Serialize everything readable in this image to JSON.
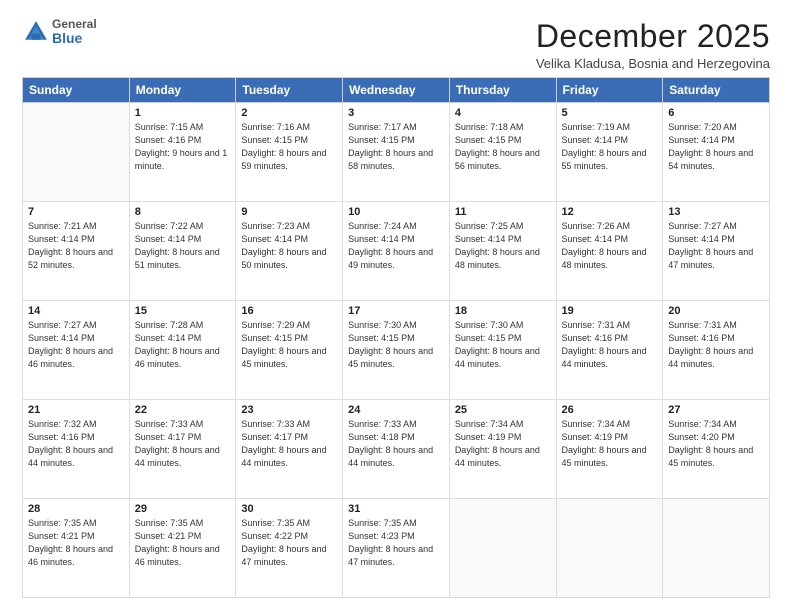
{
  "logo": {
    "general": "General",
    "blue": "Blue"
  },
  "title": "December 2025",
  "subtitle": "Velika Kladusa, Bosnia and Herzegovina",
  "days": [
    "Sunday",
    "Monday",
    "Tuesday",
    "Wednesday",
    "Thursday",
    "Friday",
    "Saturday"
  ],
  "weeks": [
    [
      {
        "num": "",
        "sunrise": "",
        "sunset": "",
        "daylight": ""
      },
      {
        "num": "1",
        "sunrise": "Sunrise: 7:15 AM",
        "sunset": "Sunset: 4:16 PM",
        "daylight": "Daylight: 9 hours and 1 minute."
      },
      {
        "num": "2",
        "sunrise": "Sunrise: 7:16 AM",
        "sunset": "Sunset: 4:15 PM",
        "daylight": "Daylight: 8 hours and 59 minutes."
      },
      {
        "num": "3",
        "sunrise": "Sunrise: 7:17 AM",
        "sunset": "Sunset: 4:15 PM",
        "daylight": "Daylight: 8 hours and 58 minutes."
      },
      {
        "num": "4",
        "sunrise": "Sunrise: 7:18 AM",
        "sunset": "Sunset: 4:15 PM",
        "daylight": "Daylight: 8 hours and 56 minutes."
      },
      {
        "num": "5",
        "sunrise": "Sunrise: 7:19 AM",
        "sunset": "Sunset: 4:14 PM",
        "daylight": "Daylight: 8 hours and 55 minutes."
      },
      {
        "num": "6",
        "sunrise": "Sunrise: 7:20 AM",
        "sunset": "Sunset: 4:14 PM",
        "daylight": "Daylight: 8 hours and 54 minutes."
      }
    ],
    [
      {
        "num": "7",
        "sunrise": "Sunrise: 7:21 AM",
        "sunset": "Sunset: 4:14 PM",
        "daylight": "Daylight: 8 hours and 52 minutes."
      },
      {
        "num": "8",
        "sunrise": "Sunrise: 7:22 AM",
        "sunset": "Sunset: 4:14 PM",
        "daylight": "Daylight: 8 hours and 51 minutes."
      },
      {
        "num": "9",
        "sunrise": "Sunrise: 7:23 AM",
        "sunset": "Sunset: 4:14 PM",
        "daylight": "Daylight: 8 hours and 50 minutes."
      },
      {
        "num": "10",
        "sunrise": "Sunrise: 7:24 AM",
        "sunset": "Sunset: 4:14 PM",
        "daylight": "Daylight: 8 hours and 49 minutes."
      },
      {
        "num": "11",
        "sunrise": "Sunrise: 7:25 AM",
        "sunset": "Sunset: 4:14 PM",
        "daylight": "Daylight: 8 hours and 48 minutes."
      },
      {
        "num": "12",
        "sunrise": "Sunrise: 7:26 AM",
        "sunset": "Sunset: 4:14 PM",
        "daylight": "Daylight: 8 hours and 48 minutes."
      },
      {
        "num": "13",
        "sunrise": "Sunrise: 7:27 AM",
        "sunset": "Sunset: 4:14 PM",
        "daylight": "Daylight: 8 hours and 47 minutes."
      }
    ],
    [
      {
        "num": "14",
        "sunrise": "Sunrise: 7:27 AM",
        "sunset": "Sunset: 4:14 PM",
        "daylight": "Daylight: 8 hours and 46 minutes."
      },
      {
        "num": "15",
        "sunrise": "Sunrise: 7:28 AM",
        "sunset": "Sunset: 4:14 PM",
        "daylight": "Daylight: 8 hours and 46 minutes."
      },
      {
        "num": "16",
        "sunrise": "Sunrise: 7:29 AM",
        "sunset": "Sunset: 4:15 PM",
        "daylight": "Daylight: 8 hours and 45 minutes."
      },
      {
        "num": "17",
        "sunrise": "Sunrise: 7:30 AM",
        "sunset": "Sunset: 4:15 PM",
        "daylight": "Daylight: 8 hours and 45 minutes."
      },
      {
        "num": "18",
        "sunrise": "Sunrise: 7:30 AM",
        "sunset": "Sunset: 4:15 PM",
        "daylight": "Daylight: 8 hours and 44 minutes."
      },
      {
        "num": "19",
        "sunrise": "Sunrise: 7:31 AM",
        "sunset": "Sunset: 4:16 PM",
        "daylight": "Daylight: 8 hours and 44 minutes."
      },
      {
        "num": "20",
        "sunrise": "Sunrise: 7:31 AM",
        "sunset": "Sunset: 4:16 PM",
        "daylight": "Daylight: 8 hours and 44 minutes."
      }
    ],
    [
      {
        "num": "21",
        "sunrise": "Sunrise: 7:32 AM",
        "sunset": "Sunset: 4:16 PM",
        "daylight": "Daylight: 8 hours and 44 minutes."
      },
      {
        "num": "22",
        "sunrise": "Sunrise: 7:33 AM",
        "sunset": "Sunset: 4:17 PM",
        "daylight": "Daylight: 8 hours and 44 minutes."
      },
      {
        "num": "23",
        "sunrise": "Sunrise: 7:33 AM",
        "sunset": "Sunset: 4:17 PM",
        "daylight": "Daylight: 8 hours and 44 minutes."
      },
      {
        "num": "24",
        "sunrise": "Sunrise: 7:33 AM",
        "sunset": "Sunset: 4:18 PM",
        "daylight": "Daylight: 8 hours and 44 minutes."
      },
      {
        "num": "25",
        "sunrise": "Sunrise: 7:34 AM",
        "sunset": "Sunset: 4:19 PM",
        "daylight": "Daylight: 8 hours and 44 minutes."
      },
      {
        "num": "26",
        "sunrise": "Sunrise: 7:34 AM",
        "sunset": "Sunset: 4:19 PM",
        "daylight": "Daylight: 8 hours and 45 minutes."
      },
      {
        "num": "27",
        "sunrise": "Sunrise: 7:34 AM",
        "sunset": "Sunset: 4:20 PM",
        "daylight": "Daylight: 8 hours and 45 minutes."
      }
    ],
    [
      {
        "num": "28",
        "sunrise": "Sunrise: 7:35 AM",
        "sunset": "Sunset: 4:21 PM",
        "daylight": "Daylight: 8 hours and 46 minutes."
      },
      {
        "num": "29",
        "sunrise": "Sunrise: 7:35 AM",
        "sunset": "Sunset: 4:21 PM",
        "daylight": "Daylight: 8 hours and 46 minutes."
      },
      {
        "num": "30",
        "sunrise": "Sunrise: 7:35 AM",
        "sunset": "Sunset: 4:22 PM",
        "daylight": "Daylight: 8 hours and 47 minutes."
      },
      {
        "num": "31",
        "sunrise": "Sunrise: 7:35 AM",
        "sunset": "Sunset: 4:23 PM",
        "daylight": "Daylight: 8 hours and 47 minutes."
      },
      {
        "num": "",
        "sunrise": "",
        "sunset": "",
        "daylight": ""
      },
      {
        "num": "",
        "sunrise": "",
        "sunset": "",
        "daylight": ""
      },
      {
        "num": "",
        "sunrise": "",
        "sunset": "",
        "daylight": ""
      }
    ]
  ]
}
